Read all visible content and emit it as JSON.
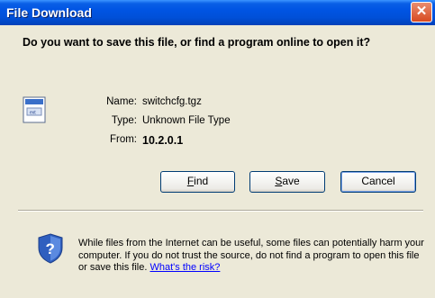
{
  "window": {
    "title": "File Download"
  },
  "prompt": {
    "question": "Do you want to save this file, or find a program online to open it?"
  },
  "file": {
    "name_label": "Name:",
    "name_value": "switchcfg.tgz",
    "type_label": "Type:",
    "type_value": "Unknown File Type",
    "from_label": "From:",
    "from_value": "10.2.0.1"
  },
  "buttons": {
    "find_accel": "F",
    "find_rest": "ind",
    "save_accel": "S",
    "save_rest": "ave",
    "cancel": "Cancel"
  },
  "info": {
    "text": "While files from the Internet can be useful, some files can potentially harm your computer. If you do not trust the source, do not find a program to open this file or save this file.",
    "link": "What's the risk?"
  },
  "icons": {
    "close": "close-icon",
    "file": "unknown-file-icon",
    "shield": "security-shield-icon"
  }
}
